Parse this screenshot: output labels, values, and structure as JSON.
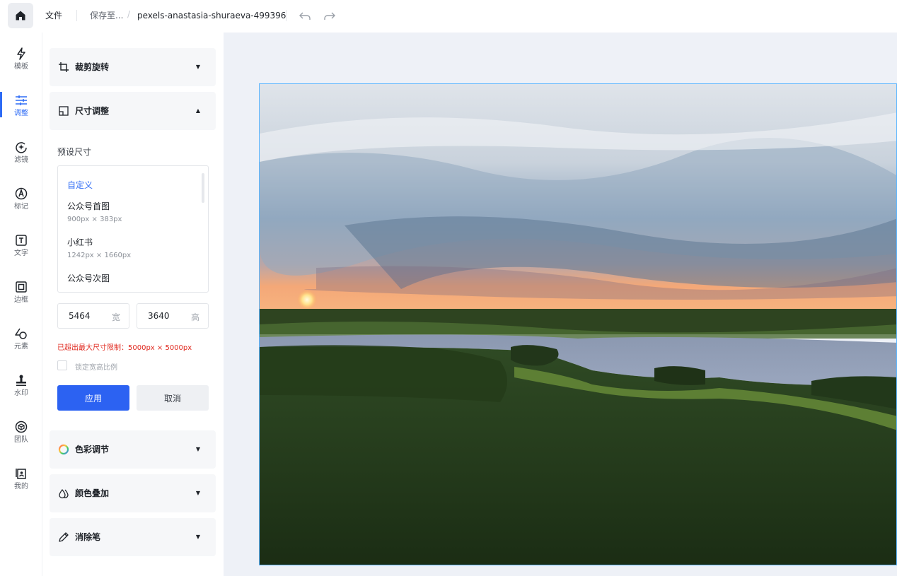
{
  "topbar": {
    "file_label": "文件",
    "save_label": "保存至...",
    "breadcrumb_sep": "/",
    "filename": "pexels-anastasia-shuraeva-499396"
  },
  "nav": {
    "items": [
      {
        "label": "模板",
        "icon": "lightning-icon"
      },
      {
        "label": "调整",
        "icon": "sliders-icon",
        "active": true
      },
      {
        "label": "滤镜",
        "icon": "filter-sparkle-icon"
      },
      {
        "label": "标记",
        "icon": "pen-mark-icon"
      },
      {
        "label": "文字",
        "icon": "text-box-icon"
      },
      {
        "label": "边框",
        "icon": "frame-icon"
      },
      {
        "label": "元素",
        "icon": "shapes-icon"
      },
      {
        "label": "水印",
        "icon": "stamp-icon"
      },
      {
        "label": "团队",
        "icon": "cube-icon"
      },
      {
        "label": "我的",
        "icon": "profile-card-icon"
      }
    ]
  },
  "panel": {
    "crop": {
      "title": "裁剪旋转",
      "caret": "▼"
    },
    "resize": {
      "title": "尺寸调整",
      "caret": "▲"
    },
    "preset_label": "预设尺寸",
    "presets": [
      {
        "name": "自定义",
        "size": ""
      },
      {
        "name": "公众号首图",
        "size": "900px × 383px"
      },
      {
        "name": "小红书",
        "size": "1242px × 1660px"
      },
      {
        "name": "公众号次图",
        "size": ""
      }
    ],
    "width": {
      "value": "5464",
      "unit": "宽"
    },
    "height": {
      "value": "3640",
      "unit": "高"
    },
    "warning": "已超出最大尺寸限制：5000px × 5000px",
    "lock_ratio": "锁定宽高比例",
    "apply": "应用",
    "cancel": "取消",
    "color_adjust": {
      "title": "色彩调节",
      "caret": "▼"
    },
    "color_overlay": {
      "title": "颜色叠加",
      "caret": "▼"
    },
    "eraser": {
      "title": "消除笔",
      "caret": "▼"
    }
  },
  "colors": {
    "accent": "#2d6bf5",
    "warning": "#e0291f",
    "canvas_bg": "#eef1f7"
  }
}
